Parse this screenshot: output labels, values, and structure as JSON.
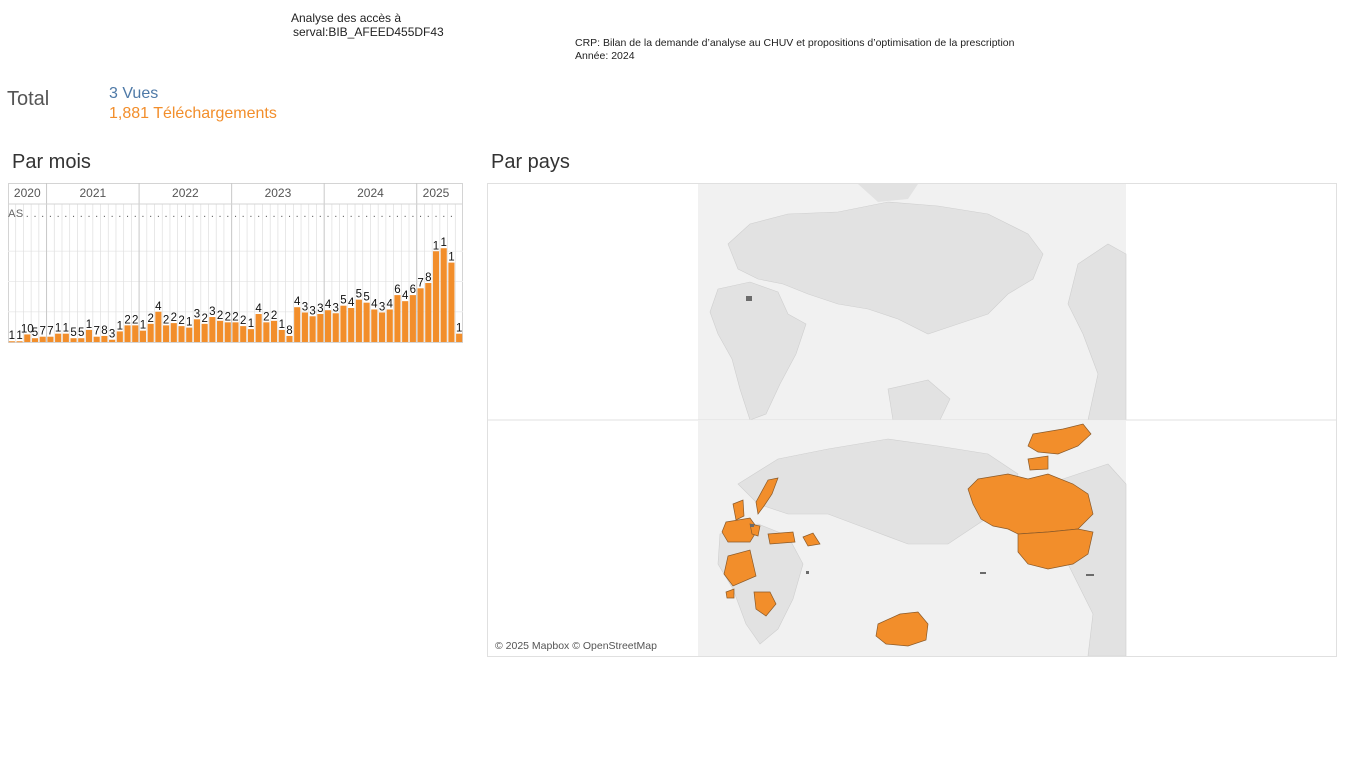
{
  "header": {
    "title_line1": "Analyse des accès à",
    "title_line2": "serval:BIB_AFEED455DF43",
    "crp_line1": "CRP: Bilan de la demande d’analyse au CHUV et propositions d’optimisation de la prescription",
    "crp_line2": "Année: 2024"
  },
  "totals": {
    "label": "Total",
    "views": "3 Vues",
    "downloads": "1,881 Téléchargements"
  },
  "sections": {
    "monthly": "Par mois",
    "country": "Par pays"
  },
  "colors": {
    "downloads": "#f28e2b",
    "views": "#4e79a7",
    "land": "#e3e3e3",
    "border": "#c8c8c8"
  },
  "chart_data": {
    "type": "bar",
    "years": [
      {
        "label": "2020",
        "months": 5
      },
      {
        "label": "2021",
        "months": 12
      },
      {
        "label": "2022",
        "months": 12
      },
      {
        "label": "2023",
        "months": 12
      },
      {
        "label": "2024",
        "months": 12
      },
      {
        "label": "2025",
        "months": 5
      }
    ],
    "month_labels": [
      "A",
      "S",
      ".",
      ".",
      ".",
      ".",
      ".",
      ".",
      ".",
      ".",
      ".",
      ".",
      ".",
      ".",
      ".",
      ".",
      ".",
      ".",
      ".",
      ".",
      ".",
      ".",
      ".",
      ".",
      ".",
      ".",
      ".",
      ".",
      ".",
      ".",
      ".",
      ".",
      ".",
      ".",
      ".",
      ".",
      ".",
      ".",
      ".",
      ".",
      ".",
      ".",
      ".",
      ".",
      ".",
      ".",
      ".",
      ".",
      ".",
      ".",
      ".",
      ".",
      ".",
      ".",
      ".",
      ".",
      ".",
      "."
    ],
    "values": [
      1,
      1,
      10,
      5,
      7,
      7,
      11,
      11,
      5,
      5,
      16,
      7,
      8,
      3,
      14,
      22,
      22,
      15,
      24,
      40,
      22,
      25,
      21,
      19,
      30,
      24,
      33,
      28,
      26,
      26,
      21,
      17,
      37,
      26,
      28,
      16,
      8,
      46,
      39,
      34,
      37,
      42,
      38,
      48,
      45,
      56,
      52,
      43,
      39,
      43,
      62,
      54,
      62,
      71,
      78,
      120,
      124,
      105,
      11
    ],
    "labels": [
      "1",
      "1",
      "10",
      "5",
      "7",
      "7",
      "1",
      "1",
      "5",
      "5",
      "1",
      "7",
      "8",
      "3",
      "1",
      "2",
      "2",
      "1",
      "2",
      "4",
      "2",
      "2",
      "2",
      "1",
      "3",
      "2",
      "3",
      "2",
      "2",
      "2",
      "2",
      "1",
      "4",
      "2",
      "2",
      "1",
      "8",
      "4",
      "3",
      "3",
      "3",
      "4",
      "3",
      "5",
      "4",
      "5",
      "5",
      "4",
      "3",
      "4",
      "6",
      "4",
      "6",
      "7",
      "8",
      "1",
      "1",
      "1",
      "1"
    ],
    "ylim": [
      0,
      160
    ]
  },
  "map": {
    "credit": "© 2025 Mapbox © OpenStreetMap"
  }
}
